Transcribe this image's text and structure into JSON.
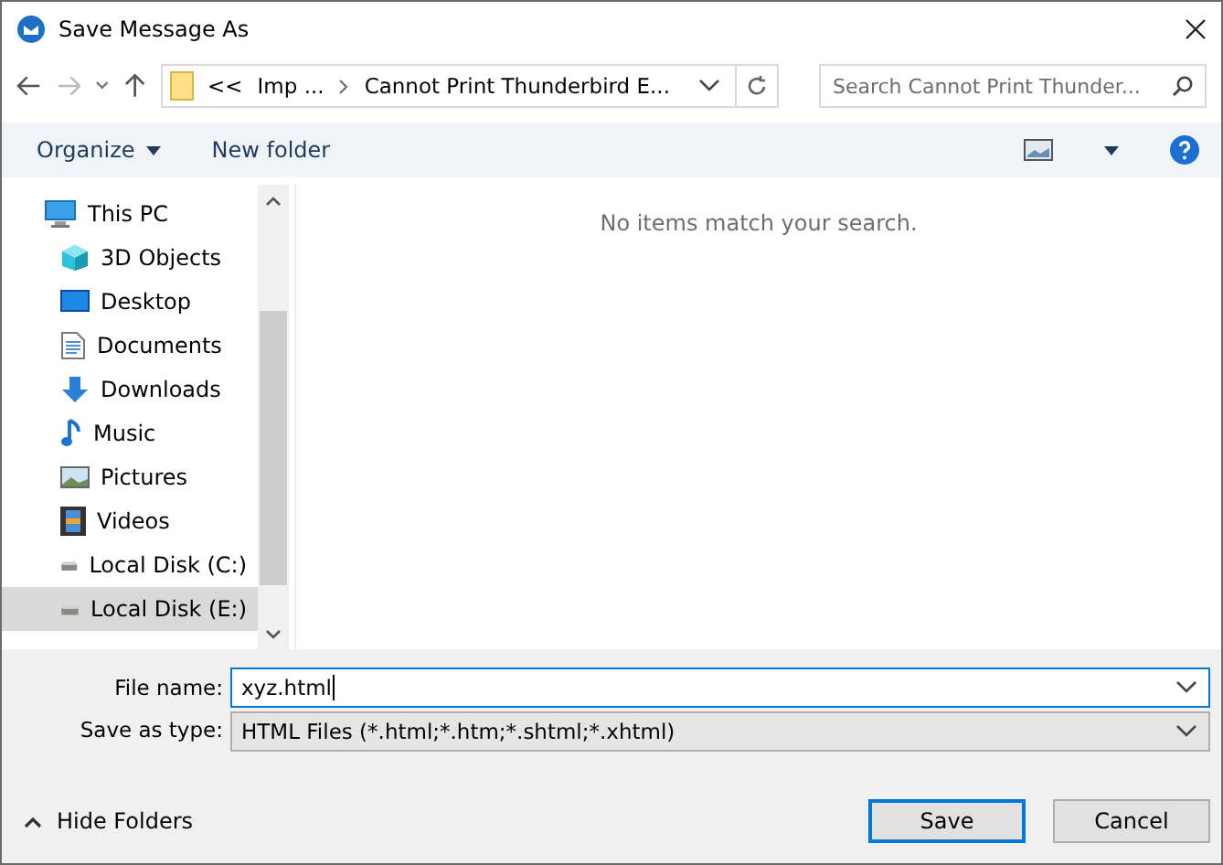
{
  "window": {
    "title": "Save Message As"
  },
  "address_bar": {
    "overflow": "<<",
    "segments": [
      "Imp ...",
      "Cannot Print Thunderbird E..."
    ]
  },
  "search": {
    "placeholder": "Search Cannot Print Thunder..."
  },
  "toolbar": {
    "organize": "Organize",
    "new_folder": "New folder"
  },
  "sidebar": {
    "items": [
      {
        "label": "This PC",
        "kind": "pc",
        "selected": false,
        "children": [
          {
            "label": "3D Objects",
            "kind": "cube",
            "selected": false
          },
          {
            "label": "Desktop",
            "kind": "desktop",
            "selected": false
          },
          {
            "label": "Documents",
            "kind": "document",
            "selected": false
          },
          {
            "label": "Downloads",
            "kind": "download",
            "selected": false
          },
          {
            "label": "Music",
            "kind": "music",
            "selected": false
          },
          {
            "label": "Pictures",
            "kind": "picture",
            "selected": false
          },
          {
            "label": "Videos",
            "kind": "video",
            "selected": false
          },
          {
            "label": "Local Disk (C:)",
            "kind": "disk",
            "selected": false
          },
          {
            "label": "Local Disk (E:)",
            "kind": "disk",
            "selected": true
          }
        ]
      }
    ]
  },
  "content": {
    "empty_message": "No items match your search."
  },
  "form": {
    "file_name_label": "File name:",
    "file_name": "xyz.html",
    "type_label": "Save as type:",
    "type": "HTML Files (*.html;*.htm;*.shtml;*.xhtml)"
  },
  "hide_folders": "Hide Folders",
  "buttons": [
    {
      "label": "Save",
      "default": true
    },
    {
      "label": "Cancel",
      "default": false
    }
  ]
}
